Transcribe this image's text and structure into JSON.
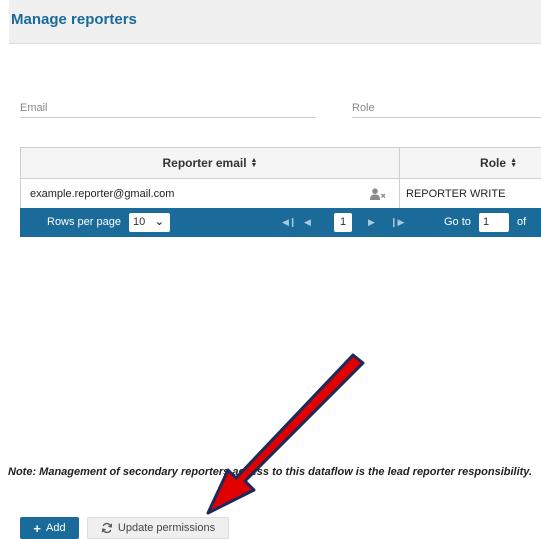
{
  "header": {
    "title": "Manage reporters"
  },
  "filters": {
    "email_placeholder": "Email",
    "role_placeholder": "Role"
  },
  "table": {
    "columns": [
      {
        "label": "Reporter email",
        "sortable": true
      },
      {
        "label": "Role",
        "sortable": true
      }
    ],
    "rows": [
      {
        "email": "example.reporter@gmail.com",
        "role": "REPORTER WRITE",
        "action_icon": "remove-user-icon"
      }
    ]
  },
  "paginator": {
    "rows_per_page_label": "Rows per page",
    "rows_per_page_value": "10",
    "current_page": "1",
    "goto_label": "Go to",
    "goto_value": "1",
    "of_label": "of"
  },
  "note": "Note: Management of secondary reporters access to this dataflow is the lead reporter responsibility.",
  "buttons": {
    "add_label": "Add",
    "update_label": "Update permissions"
  },
  "colors": {
    "accent": "#1a6b9a",
    "arrow_fill": "#e00000",
    "arrow_outline": "#1c2a5a"
  }
}
